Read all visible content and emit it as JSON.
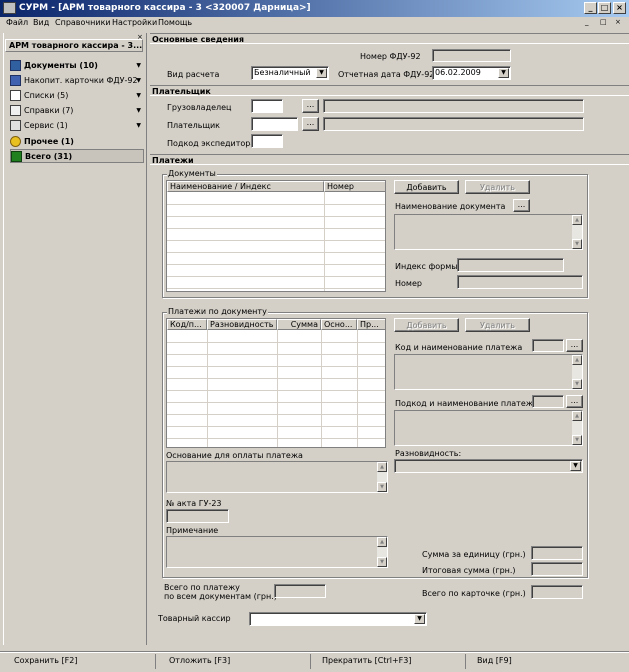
{
  "window": {
    "title": "СУРМ - [АРМ товарного кассира - 3 <320007 Дарница>]",
    "controls": [
      "_",
      "□",
      "×"
    ],
    "inner_controls": [
      "_",
      "□",
      "×"
    ]
  },
  "menu": {
    "items": [
      {
        "label": "Файл"
      },
      {
        "label": "Вид"
      },
      {
        "label": "Справочники"
      },
      {
        "label": "Настройки"
      },
      {
        "label": "Помощь"
      }
    ]
  },
  "sidebar": {
    "header": "АРМ товарного кассира - 3...",
    "close": "×",
    "items": [
      {
        "label": "Документы (10)",
        "bold": true,
        "icon": "documents-icon",
        "arrow": "▼"
      },
      {
        "label": "Накопит. карточки ФДУ-92",
        "bold": false,
        "icon": "cards-icon",
        "arrow": "▼"
      },
      {
        "label": "Списки (5)",
        "bold": false,
        "icon": "lists-icon",
        "arrow": "▼"
      },
      {
        "label": "Справки (7)",
        "bold": false,
        "icon": "reports-icon",
        "arrow": "▼"
      },
      {
        "label": "Сервис (1)",
        "bold": false,
        "icon": "service-icon",
        "arrow": "▼"
      },
      {
        "label": "Прочее (1)",
        "bold": true,
        "icon": "other-icon",
        "arrow": ""
      },
      {
        "label": "Всего (31)",
        "bold": true,
        "icon": "total-icon",
        "arrow": ""
      }
    ]
  },
  "main": {
    "basic": {
      "title": "Основные сведения",
      "fdu_number_label": "Номер ФДУ-92",
      "fdu_number_value": "",
      "calc_type_label": "Вид расчета",
      "calc_type_value": "Безналичный",
      "report_date_label": "Отчетная дата ФДУ-92",
      "report_date_value": "06.02.2009"
    },
    "payer": {
      "title": "Плательщик",
      "owner_label": "Грузовладелец",
      "payer_label": "Плательщик",
      "forwarder_label": "Подкод экспедитора",
      "browse": "..."
    },
    "payments": {
      "title": "Платежи",
      "documents_group": "Документы",
      "doc_columns": [
        "Наименование / Индекс",
        "Номер"
      ],
      "add_label": "Добавить",
      "delete_label": "Удалить",
      "doc_name_label": "Наименование документа",
      "form_index_label": "Индекс формы",
      "number_label": "Номер",
      "by_doc_group": "Платежи по документу",
      "pay_columns": [
        "Код/п...",
        "Разновидность",
        "Сумма",
        "Осно...",
        "Пр..."
      ],
      "code_name_label": "Код и наименование платежа",
      "subcode_name_label": "Подкод и наименование платежа",
      "variety_label": "Разновидность:",
      "basis_label": "Основание для оплаты платежа",
      "act_label": "№ акта ГУ-23",
      "note_label": "Примечание",
      "unit_sum_label": "Сумма за единицу (грн.)",
      "total_sum_label": "Итоговая сумма (грн.)",
      "total_payment_label_1": "Всего по платежу",
      "total_payment_label_2": "по всем документам (грн.)",
      "total_card_label": "Всего по карточке (грн.)",
      "cashier_label": "Товарный кассир",
      "browse": "..."
    }
  },
  "statusbar": {
    "items": [
      "Сохранить [F2]",
      "Отложить [F3]",
      "Прекратить [Ctrl+F3]",
      "Вид [F9]"
    ]
  }
}
